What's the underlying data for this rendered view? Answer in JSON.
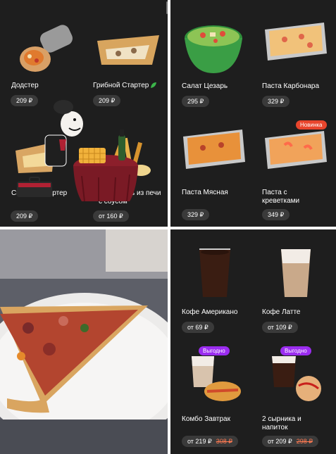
{
  "panel1": {
    "items": [
      {
        "name": "Додстер",
        "price": "209 ₽"
      },
      {
        "name": "Грибной Стартер",
        "price": "209 ₽"
      },
      {
        "name": "Сырный Стартер",
        "price": "209 ₽"
      },
      {
        "name": "Картофель из печи с соусом",
        "price": "от 160 ₽"
      }
    ]
  },
  "panel2": {
    "items": [
      {
        "name": "Салат Цезарь",
        "price": "295 ₽"
      },
      {
        "name": "Паста Карбонара",
        "price": "329 ₽"
      },
      {
        "name": "Паста Мясная",
        "price": "329 ₽"
      },
      {
        "name": "Паста с креветками",
        "price": "349 ₽",
        "badge": "Новинка"
      }
    ],
    "badge_color": "#e8452c"
  },
  "panel4": {
    "items": [
      {
        "name": "Кофе Американо",
        "price": "от 69 ₽"
      },
      {
        "name": "Кофе Латте",
        "price": "от 109 ₽"
      },
      {
        "name": "Комбо Завтрак",
        "price": "от 219 ₽",
        "old_price": "308 ₽",
        "badge": "Выгодно"
      },
      {
        "name": "2 сырника и напиток",
        "price": "от 209 ₽",
        "old_price": "298 ₽",
        "badge": "Выгодно"
      }
    ],
    "badge_color": "#9b2cf0"
  },
  "icons": [
    "vegetarian-leaf-icon",
    "restaurant-chef-logo-icon"
  ]
}
